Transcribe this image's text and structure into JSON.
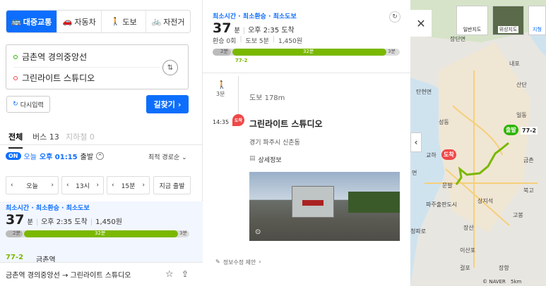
{
  "modes": [
    {
      "label": "대중교통",
      "icon": "bus-icon",
      "active": true
    },
    {
      "label": "자동차",
      "icon": "car-icon"
    },
    {
      "label": "도보",
      "icon": "walk-icon"
    },
    {
      "label": "자전거",
      "icon": "bike-icon"
    }
  ],
  "origin": "금촌역 경의중앙선",
  "destination": "그린라이트 스튜디오",
  "reset_label": "다시입력",
  "search_label": "길찾기",
  "tabs": {
    "all": "전체",
    "bus": "버스 13",
    "subway": "지하철 0"
  },
  "depart": {
    "badge": "ON",
    "text_prefix": "오늘",
    "time": "오후 01:15",
    "suffix": "출발"
  },
  "sort": "최적 경로순",
  "timebar": {
    "day": "오늘",
    "hour": "13시",
    "minute": "15분",
    "now": "지금 출발"
  },
  "route": {
    "tags": "최소시간 · 최소환승 · 최소도보",
    "minutes": "37",
    "unit": "분",
    "arrival": "오후 2:35 도착",
    "transfer": "환승 0회",
    "walk": "도보 5분",
    "fare": "1,450원",
    "bar_pre": "2분",
    "bar_bus": "32분",
    "bar_post": "3분",
    "bus_no": "77-2",
    "first_stop": "금촌역"
  },
  "footer": {
    "from_to": "금촌역 경의중앙선 → 그린라이트 스튜디오"
  },
  "detail": {
    "walk_min": "3분",
    "walk_dist": "도보 178m",
    "arrive_time": "14:35",
    "arrive_badge": "도착",
    "place_name": "그린라이트 스튜디오",
    "address": "경기 파주시 신촌동",
    "detail_link": "상세정보",
    "report": "정보수정 제안"
  },
  "map": {
    "btn_normal": "일반지도",
    "btn_satellite": "위성지도",
    "btn_terrain": "지형",
    "labels": [
      "장단면",
      "내포",
      "산단",
      "일동",
      "탄현면",
      "성동",
      "금촌",
      "문발",
      "파주출판도시",
      "상지석",
      "교하",
      "탄현",
      "고봉",
      "장산",
      "이산포",
      "청파로",
      "걸포",
      "장항",
      "금촌",
      "북고",
      "면"
    ],
    "start_badge": "출발",
    "end_badge": "도착",
    "bus_tag": "77-2",
    "scale": "5km",
    "brand": "© NAVER"
  }
}
